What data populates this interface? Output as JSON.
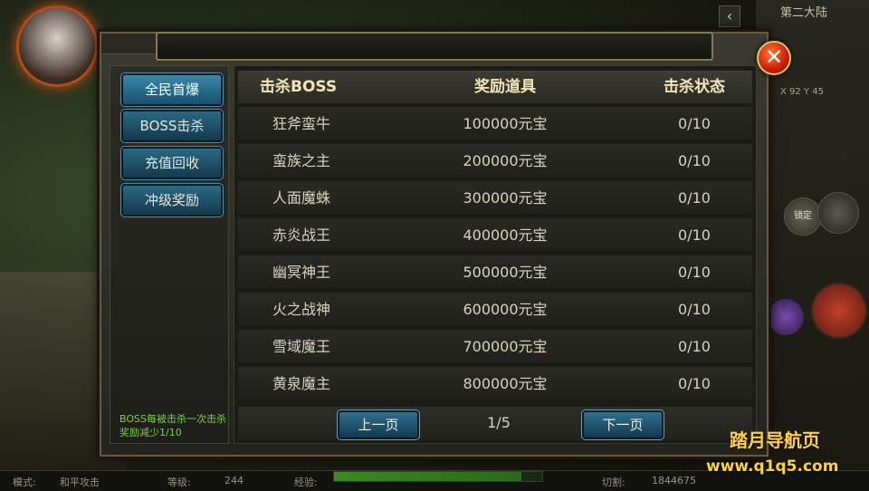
{
  "background": {
    "map_name": "第二大陆",
    "coords": "X 92 Y 45",
    "lock_label": "锁定"
  },
  "statusbar": {
    "mode_label": "模式:",
    "mode_value": "和平攻击",
    "level_label": "等级:",
    "level_value": "244",
    "exp_label": "经验:",
    "exp_progress": 0.9,
    "kill_label": "切割:",
    "kill_value": "1844675"
  },
  "sidebar": {
    "items": [
      {
        "label": "全民首爆",
        "active": true
      },
      {
        "label": "BOSS击杀",
        "active": false
      },
      {
        "label": "充值回收",
        "active": false
      },
      {
        "label": "冲级奖励",
        "active": false
      }
    ],
    "note": "BOSS每被击杀一次击杀奖励减少1/10"
  },
  "table": {
    "headers": [
      "击杀BOSS",
      "奖励道具",
      "击杀状态"
    ],
    "rows": [
      [
        "狂斧蛮牛",
        "100000元宝",
        "0/10"
      ],
      [
        "蛮族之主",
        "200000元宝",
        "0/10"
      ],
      [
        "人面魔蛛",
        "300000元宝",
        "0/10"
      ],
      [
        "赤炎战王",
        "400000元宝",
        "0/10"
      ],
      [
        "幽冥神王",
        "500000元宝",
        "0/10"
      ],
      [
        "火之战神",
        "600000元宝",
        "0/10"
      ],
      [
        "雪域魔王",
        "700000元宝",
        "0/10"
      ],
      [
        "黄泉魔主",
        "800000元宝",
        "0/10"
      ]
    ]
  },
  "pager": {
    "prev_label": "上一页",
    "page": "1/5",
    "next_label": "下一页"
  },
  "close_icon": "close-x",
  "watermark": {
    "line1": "踏月导航页",
    "line2": "www.q1q5.com"
  }
}
